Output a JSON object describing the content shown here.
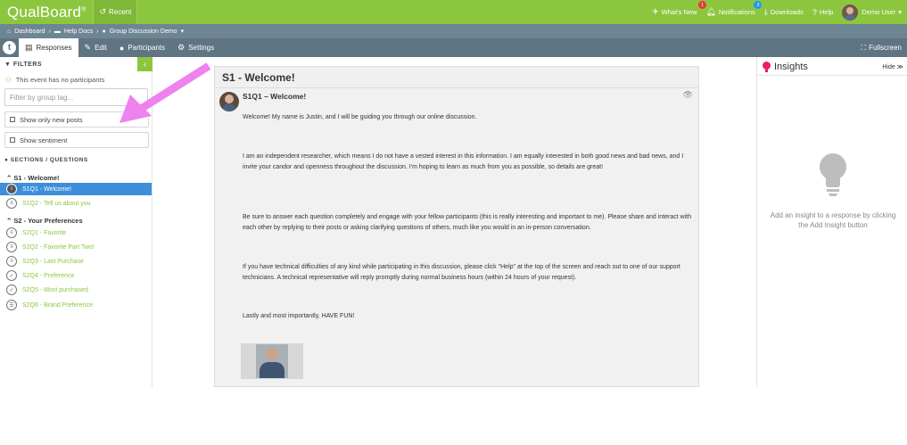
{
  "app": {
    "logo": "QualBoard",
    "logo_mark": "®",
    "recent_label": "Recent"
  },
  "topnav": {
    "whats_new": "What's New",
    "whats_new_badge": "1",
    "notifications": "Notifications",
    "notifications_badge": "3",
    "downloads": "Downloads",
    "help": "Help",
    "user": "Demo User"
  },
  "breadcrumb": {
    "dashboard": "Dashboard",
    "help_docs": "Help Docs",
    "current": "Group Discussion Demo"
  },
  "tabs": {
    "logo_letter": "t",
    "responses": "Responses",
    "edit": "Edit",
    "participants": "Participants",
    "settings": "Settings",
    "fullscreen": "Fullscreen"
  },
  "sidebar": {
    "filters_title": "FILTERS",
    "no_participants": "This event has no participants",
    "group_tag_placeholder": "Filter by group tag...",
    "show_new_posts": "Show only new posts",
    "show_sentiment": "Show sentiment",
    "sections_title": "SECTIONS / QUESTIONS",
    "sections": [
      {
        "title": "S1 - Welcome!",
        "items": [
          {
            "label": "S1Q1 - Welcome!",
            "icon": "info"
          },
          {
            "label": "S1Q2 - Tell us about you",
            "icon": "chat"
          }
        ]
      },
      {
        "title": "S2 - Your Preferences",
        "items": [
          {
            "label": "S2Q1 - Favorite",
            "icon": "chat"
          },
          {
            "label": "S2Q2 - Favorite Part Two!",
            "icon": "chat"
          },
          {
            "label": "S2Q3 - Last Purchase",
            "icon": "chat"
          },
          {
            "label": "S2Q4 - Preference",
            "icon": "check"
          },
          {
            "label": "S2Q5 - Most purchased",
            "icon": "check"
          },
          {
            "label": "S2Q6 - Brand Preference",
            "icon": "list"
          }
        ]
      }
    ]
  },
  "main": {
    "section_title": "S1 - Welcome!",
    "post_title": "S1Q1 – Welcome!",
    "paragraphs": [
      "Welcome! My name is Justin, and I will be guiding you through our online discussion.",
      "I am an independent researcher, which means I do not have a vested interest in this information. I am equally interested in both good news and bad news, and I invite your candor and openness throughout the discussion. I'm hoping to learn as much from you as possible, so details are great!",
      "Be sure to answer each question completely and engage with your fellow participants (this is really interesting and important to me). Please share and interact with each other by replying to their posts or asking clarifying questions of others, much like you would in an in-person conversation.",
      "If you have technical difficulties of any kind while participating in this discussion, please click \"Help\" at the top of the screen and reach out to one of our support technicians. A technical representative will reply promptly during normal business hours (within 24 hours of your request).",
      "Lastly and most importantly, HAVE FUN!"
    ]
  },
  "insights": {
    "title": "Insights",
    "hide": "Hide ≫",
    "empty_text": "Add an insight to a response by clicking the Add Insight button"
  },
  "colors": {
    "brand_green": "#8cc63f",
    "nav_slate": "#5f7584",
    "active_blue": "#3d8fd9",
    "annotation_arrow": "#ee82ee",
    "insight_pink": "#e91e63"
  }
}
